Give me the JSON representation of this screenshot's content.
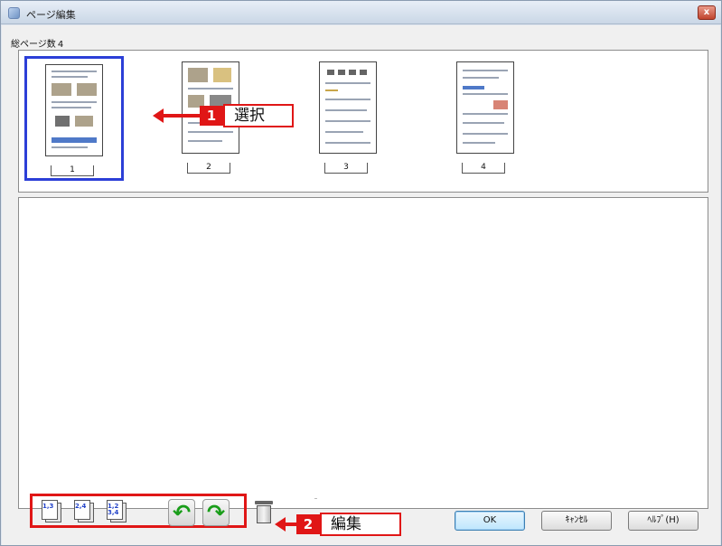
{
  "window": {
    "title": "ページ編集",
    "close_label": "x"
  },
  "status": {
    "total_pages_label": "総ページ数",
    "total_pages": "4"
  },
  "thumbnails": [
    {
      "page": "1",
      "selected": true
    },
    {
      "page": "2",
      "selected": false
    },
    {
      "page": "3",
      "selected": false
    },
    {
      "page": "4",
      "selected": false
    }
  ],
  "callouts": {
    "select": {
      "number": "1",
      "label": "選択"
    },
    "edit": {
      "number": "2",
      "label": "編集"
    }
  },
  "toolbar": {
    "tools": [
      {
        "icon": "odd-pages-icon",
        "text": "1,3"
      },
      {
        "icon": "even-pages-icon",
        "text": "2,4"
      },
      {
        "icon": "all-pages-icon",
        "text": "1,2 3,4"
      }
    ],
    "rotate_left_glyph": "↶",
    "rotate_right_glyph": "↷"
  },
  "buttons": {
    "ok": "OK",
    "cancel": "ｷｬﾝｾﾙ",
    "help": "ﾍﾙﾌﾟ(H)"
  },
  "colors": {
    "accent_red": "#e01616",
    "selection_blue": "#2c3fd7"
  }
}
